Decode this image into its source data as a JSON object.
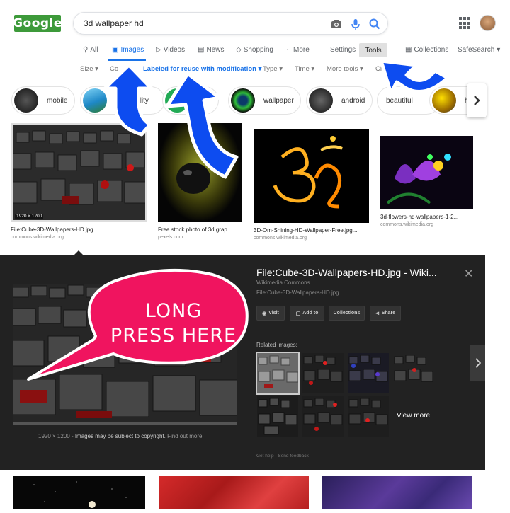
{
  "logo": {
    "text": "Google"
  },
  "search": {
    "query": "3d wallpaper hd"
  },
  "tabs": {
    "all": "All",
    "images": "Images",
    "videos": "Videos",
    "news": "News",
    "shopping": "Shopping",
    "more": "More",
    "settings": "Settings",
    "tools": "Tools",
    "collections": "Collections",
    "safesearch": "SafeSearch"
  },
  "filters": {
    "size": "Size",
    "color": "Co",
    "usage": "Labeled for reuse with modification",
    "type": "Type",
    "time": "Time",
    "more_tools": "More tools",
    "clear": "Cl"
  },
  "chips": [
    "mobile",
    "quality",
    "wallpaper",
    "android",
    "beautiful",
    "hi"
  ],
  "results": [
    {
      "title": "File:Cube-3D-Wallpapers-HD.jpg ...",
      "source": "commons.wikimedia.org",
      "dims": "1920 × 1200"
    },
    {
      "title": "Free stock photo of 3d grap...",
      "source": "pexels.com"
    },
    {
      "title": "3D-Om-Shining-HD-Wallpaper-Free.jpg...",
      "source": "commons.wikimedia.org"
    },
    {
      "title": "3d-flowers-hd-wallpapers-1-2...",
      "source": "commons.wikimedia.org"
    }
  ],
  "panel": {
    "title": "File:Cube-3D-Wallpapers-HD.jpg - Wiki...",
    "site": "Wikimedia Commons",
    "filename": "File:Cube-3D-Wallpapers-HD.jpg",
    "buttons": {
      "visit": "Visit",
      "add": "Add to",
      "collections": "Collections",
      "share": "Share"
    },
    "related_label": "Related images:",
    "view_more": "View more",
    "dims": "1920 × 1200",
    "copyright": "Images may be subject to copyright.",
    "find_out_more": "Find out more",
    "help": "Get help",
    "feedback": "Send feedback"
  },
  "annotation": {
    "line1": "LONG",
    "line2": "PRESS HERE"
  },
  "colors": {
    "accent": "#1a73e8",
    "arrow": "#0d4cf0",
    "bubble": "#f0145f"
  }
}
